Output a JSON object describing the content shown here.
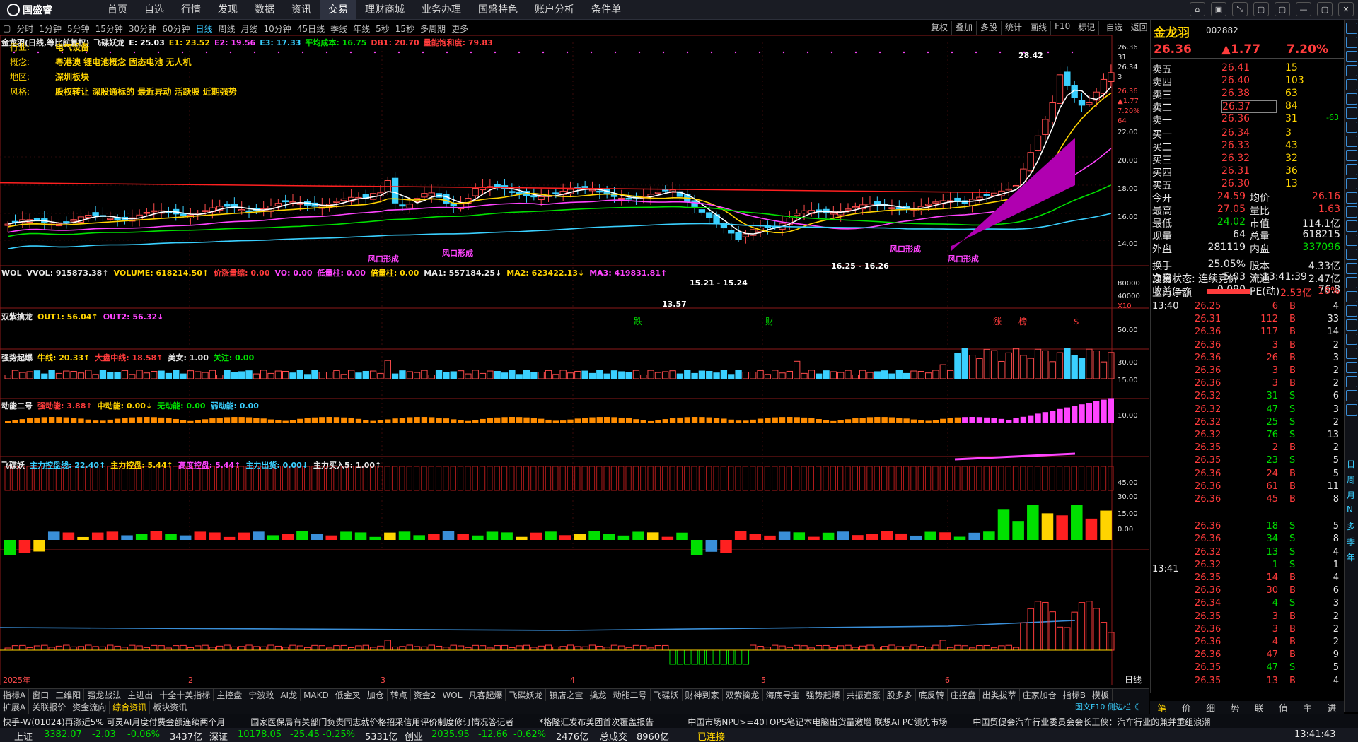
{
  "app": {
    "logo": "国盛睿",
    "nav": [
      "首页",
      "自选",
      "行情",
      "发现",
      "数据",
      "资讯",
      "交易",
      "理财商城",
      "业务办理",
      "国盛特色",
      "账户分析",
      "条件单"
    ],
    "active_nav": "交易"
  },
  "window_buttons": [
    "⌂",
    "▣",
    "⤡",
    "▢",
    "▢",
    "—",
    "▢",
    "✕"
  ],
  "periods": [
    "分时",
    "1分钟",
    "5分钟",
    "15分钟",
    "30分钟",
    "60分钟",
    "日线",
    "周线",
    "月线",
    "10分钟",
    "45日线",
    "季线",
    "年线",
    "5秒",
    "15秒",
    "多周期",
    "更多"
  ],
  "selected_period": "日线",
  "tools": [
    "复权",
    "叠加",
    "多股",
    "统计",
    "画线",
    "F10",
    "标记",
    "-自选",
    "返回"
  ],
  "title_line": [
    {
      "t": "金龙羽(日线,等比前复权)",
      "c": "#e8e8e8"
    },
    {
      "t": "飞碟妖龙",
      "c": "#e8e8e8"
    },
    {
      "t": "E: 25.03",
      "c": "#ffffff"
    },
    {
      "t": "E1: 23.52",
      "c": "#ffd400"
    },
    {
      "t": "E2: 19.56",
      "c": "#ff44ff"
    },
    {
      "t": "E3: 17.33",
      "c": "#3ad0ff"
    },
    {
      "t": "平均成本: 16.75",
      "c": "#00e000"
    },
    {
      "t": "DB1: 20.70",
      "c": "#ff3c3c"
    },
    {
      "t": "量能饱和度: 79.83",
      "c": "#ff3c3c"
    }
  ],
  "info": [
    {
      "k": "行业:",
      "v": "电气设备"
    },
    {
      "k": "概念:",
      "v": "粤港澳 锂电池概念 固态电池 无人机"
    },
    {
      "k": "地区:",
      "v": "深圳板块"
    },
    {
      "k": "风格:",
      "v": "股权转让 深股通标的 最近异动 活跃股 近期强势"
    }
  ],
  "chart_labels": {
    "high": "28.42",
    "low": "13.57",
    "range1": "15.21 - 15.24",
    "range2": "16.25 - 16.26",
    "fk1": "风口形成",
    "fk2": "风口形成",
    "fk3": "风口形成",
    "fk4": "风口形成",
    "marks": [
      "跌",
      "财",
      "涨",
      "榜",
      "$"
    ]
  },
  "yaxis_main": [
    "26.36",
    "31",
    "26.34",
    "3",
    "26.36",
    "▲1.77",
    "7.20%",
    "64",
    "22.00",
    "20.00",
    "18.00",
    "16.00",
    "14.00"
  ],
  "panels": [
    {
      "title": [
        {
          "t": "WOL",
          "c": "#e8e8e8"
        },
        {
          "t": "VVOL: 915873.38↑",
          "c": "#e8e8e8"
        },
        {
          "t": "VOLUME: 618214.50↑",
          "c": "#ffd400"
        },
        {
          "t": "价涨量缩: 0.00",
          "c": "#ff3c3c"
        },
        {
          "t": "VO: 0.00",
          "c": "#ff44ff"
        },
        {
          "t": "低量柱: 0.00",
          "c": "#ff44ff"
        },
        {
          "t": "倍量柱: 0.00",
          "c": "#ffd400"
        },
        {
          "t": "MA1: 557184.25↓",
          "c": "#e8e8e8"
        },
        {
          "t": "MA2: 623422.13↓",
          "c": "#ffd400"
        },
        {
          "t": "MA3: 419831.81↑",
          "c": "#ff44ff"
        }
      ],
      "y": [
        "80000",
        "40000",
        "X10"
      ]
    },
    {
      "title": [
        {
          "t": "双紫擒龙",
          "c": "#e8e8e8"
        },
        {
          "t": "OUT1: 56.04↑",
          "c": "#ffd400"
        },
        {
          "t": "OUT2: 56.32↓",
          "c": "#ff44ff"
        }
      ],
      "y": [
        "50.00"
      ]
    },
    {
      "title": [
        {
          "t": "强势起爆",
          "c": "#e8e8e8"
        },
        {
          "t": "牛线: 20.33↑",
          "c": "#ffd400"
        },
        {
          "t": "大盘中线: 18.58↑",
          "c": "#ff3c3c"
        },
        {
          "t": "美女: 1.00",
          "c": "#e8e8e8"
        },
        {
          "t": "关注: 0.00",
          "c": "#00e000"
        }
      ],
      "y": [
        "30.00",
        "15.00"
      ]
    },
    {
      "title": [
        {
          "t": "动能二号",
          "c": "#e8e8e8"
        },
        {
          "t": "强动能: 3.88↑",
          "c": "#ff3c3c"
        },
        {
          "t": "中动能: 0.00↓",
          "c": "#ffd400"
        },
        {
          "t": "无动能: 0.00",
          "c": "#00e000"
        },
        {
          "t": "弱动能: 0.00",
          "c": "#3ad0ff"
        }
      ],
      "y": [
        "10.00"
      ]
    },
    {
      "title": [
        {
          "t": "飞碟妖",
          "c": "#e8e8e8"
        },
        {
          "t": "主力控盘线: 22.40↑",
          "c": "#3ad0ff"
        },
        {
          "t": "主力控盘: 5.44↑",
          "c": "#ffd400"
        },
        {
          "t": "高度控盘: 5.44↑",
          "c": "#ff44ff"
        },
        {
          "t": "主力出货: 0.00↓",
          "c": "#3ad0ff"
        },
        {
          "t": "主力买入5: 1.00↑",
          "c": "#e8e8e8"
        }
      ],
      "y": [
        "45.00",
        "30.00",
        "15.00",
        "0.00"
      ]
    }
  ],
  "xaxis": [
    "2025年",
    "2",
    "3",
    "4",
    "5",
    "6"
  ],
  "xaxis_right": "日线",
  "stock": {
    "name": "金龙羽",
    "code": "002882",
    "price": "26.36",
    "change": "▲1.77",
    "pct": "7.20%"
  },
  "orderbook": [
    {
      "l": "卖五",
      "p": "26.41",
      "v": "15",
      "x": ""
    },
    {
      "l": "卖四",
      "p": "26.40",
      "v": "103",
      "x": ""
    },
    {
      "l": "卖三",
      "p": "26.38",
      "v": "63",
      "x": ""
    },
    {
      "l": "卖二",
      "p": "26.37",
      "v": "84",
      "x": ""
    },
    {
      "l": "卖一",
      "p": "26.36",
      "v": "31",
      "x": "-63"
    },
    {
      "l": "买一",
      "p": "26.34",
      "v": "3",
      "x": ""
    },
    {
      "l": "买二",
      "p": "26.33",
      "v": "43",
      "x": ""
    },
    {
      "l": "买三",
      "p": "26.32",
      "v": "32",
      "x": ""
    },
    {
      "l": "买四",
      "p": "26.31",
      "v": "36",
      "x": ""
    },
    {
      "l": "买五",
      "p": "26.30",
      "v": "13",
      "x": ""
    }
  ],
  "stats": [
    {
      "a": "今开",
      "b": "24.59",
      "c": "均价",
      "d": "26.16"
    },
    {
      "a": "最高",
      "b": "27.05",
      "c": "量比",
      "d": "1.63"
    },
    {
      "a": "最低",
      "b": "24.02",
      "c": "市值",
      "d": "114.1亿"
    },
    {
      "a": "现量",
      "b": "64",
      "c": "总量",
      "d": "618215"
    },
    {
      "a": "外盘",
      "b": "281119",
      "c": "内盘",
      "d": "337096"
    },
    {
      "a": "换手",
      "b": "25.05%",
      "c": "股本",
      "d": "4.33亿"
    },
    {
      "a": "净资",
      "b": "5.03",
      "c": "流通",
      "d": "2.47亿"
    },
    {
      "a": "收益(一)",
      "b": "0.090",
      "c": "PE(动)",
      "d": "76.8"
    }
  ],
  "trade_status": "交易状态: 连续竞价",
  "trade_time": "13:41:39",
  "net_label": "主力净额",
  "net_value": "2.53亿",
  "net_pct": "16%",
  "ticks_time1": "13:40",
  "ticks_time2": "13:41",
  "ticks": [
    [
      "26.25",
      "6",
      "B",
      "4"
    ],
    [
      "26.31",
      "112",
      "B",
      "33"
    ],
    [
      "26.36",
      "117",
      "B",
      "14"
    ],
    [
      "26.36",
      "3",
      "B",
      "2"
    ],
    [
      "26.36",
      "26",
      "B",
      "3"
    ],
    [
      "26.36",
      "3",
      "B",
      "2"
    ],
    [
      "26.36",
      "3",
      "B",
      "2"
    ],
    [
      "26.32",
      "31",
      "S",
      "6"
    ],
    [
      "26.32",
      "47",
      "S",
      "3"
    ],
    [
      "26.32",
      "25",
      "S",
      "2"
    ],
    [
      "26.32",
      "76",
      "S",
      "13"
    ],
    [
      "26.35",
      "2",
      "B",
      "2"
    ],
    [
      "26.35",
      "23",
      "S",
      "5"
    ],
    [
      "26.36",
      "24",
      "B",
      "5"
    ],
    [
      "26.36",
      "61",
      "B",
      "11"
    ],
    [
      "26.36",
      "45",
      "B",
      "8"
    ],
    [
      "26.36",
      "18",
      "S",
      "5"
    ],
    [
      "26.36",
      "34",
      "S",
      "8"
    ],
    [
      "26.32",
      "13",
      "S",
      "4"
    ],
    [
      "26.32",
      "1",
      "S",
      "1"
    ],
    [
      "26.35",
      "14",
      "B",
      "4"
    ],
    [
      "26.36",
      "30",
      "B",
      "6"
    ],
    [
      "26.34",
      "4",
      "S",
      "3"
    ],
    [
      "26.35",
      "3",
      "B",
      "2"
    ],
    [
      "26.36",
      "3",
      "B",
      "2"
    ],
    [
      "26.36",
      "4",
      "B",
      "2"
    ],
    [
      "26.36",
      "47",
      "B",
      "9"
    ],
    [
      "26.35",
      "47",
      "S",
      "5"
    ],
    [
      "26.35",
      "13",
      "B",
      "4"
    ]
  ],
  "side_labels": [
    "日",
    "周",
    "月",
    "N",
    "多",
    "季",
    "年"
  ],
  "tabs1": [
    "指标A",
    "窗口",
    "三维阳",
    "强龙战法",
    "主进出",
    "十全十美指标",
    "主控盘",
    "宁波敢",
    "AI龙",
    "MAKD",
    "低金叉",
    "加仓",
    "转点",
    "资金2",
    "WOL",
    "凡客起爆",
    "飞碟妖龙",
    "镇店之宝",
    "擒龙",
    "动能二号",
    "飞碟妖",
    "财神到家",
    "双紫擒龙",
    "海底寻宝",
    "强势起爆",
    "共振追涨",
    "股多多",
    "底反转",
    "庄控盘",
    "出类拔萃",
    "庄家加仓",
    "指标B",
    "模板"
  ],
  "tabs2": [
    "扩展A",
    "关联报价",
    "资金流向",
    "综合资讯",
    "板块资讯"
  ],
  "tabs2_sel": "综合资讯",
  "right_tab_caption": "图文F10 侧边栏《",
  "rtabs": [
    "笔",
    "价",
    "细",
    "势",
    "联",
    "值",
    "主",
    "进"
  ],
  "news": "快手-W(01024)再涨近5% 可灵AI月度付费金额连续两个月　　　国家医保局有关部门负责同志就价格招采信用评价制度修订情况答记者　　　*格隆汇发布美团首次覆盖报告　　　　中国市场NPU>=40TOPS笔记本电脑出货量激增 联想AI PC领先市场　　　中国贸促会汽车行业委员会会长王侠：汽车行业的兼并重组浪潮",
  "status": {
    "sh": "上证",
    "sh_v": "3382.07",
    "sh_c": "-2.03",
    "sh_p": "-0.06%",
    "sh_a": "3437亿",
    "sz": "深证",
    "sz_v": "10178.05",
    "sz_c": "-25.45",
    "sz_p": "-0.25%",
    "sz_a": "5331亿",
    "cy": "创业",
    "cy_v": "2035.95",
    "cy_c": "-12.66",
    "cy_p": "-0.62%",
    "cy_a": "2476亿",
    "tot": "总成交",
    "tot_v": "8960亿",
    "conn": "已连接",
    "time": "13:41:43"
  }
}
